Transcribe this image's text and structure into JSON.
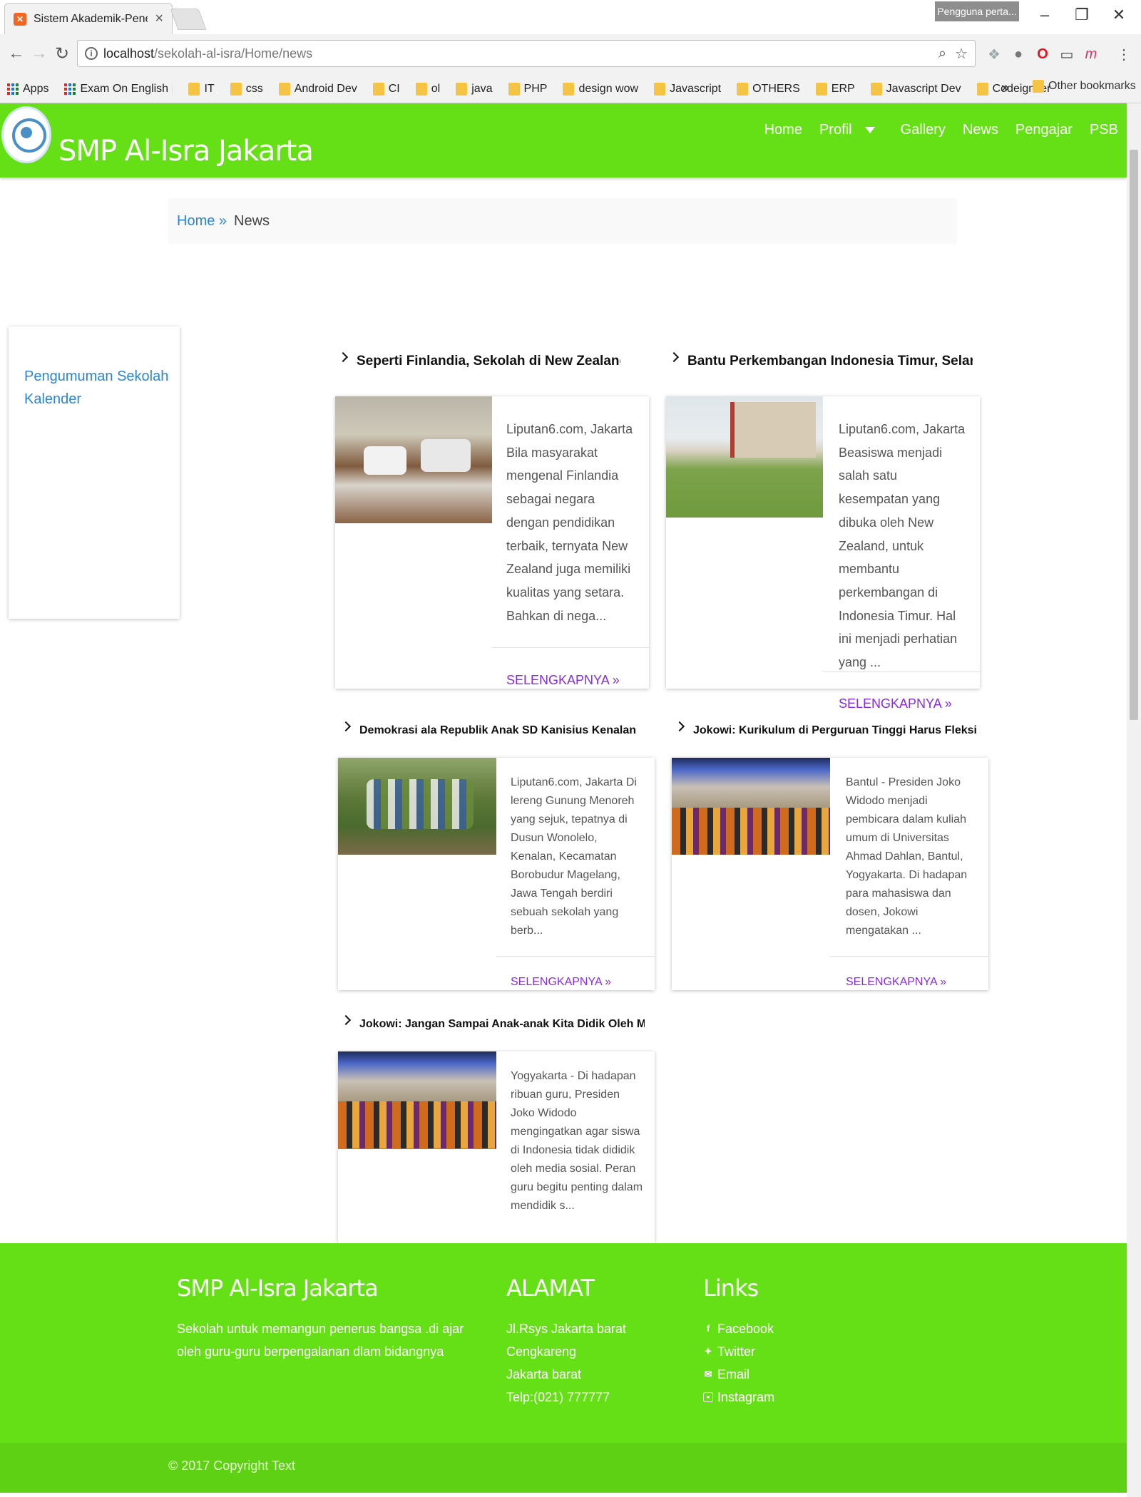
{
  "browser": {
    "tab_title": "Sistem Akademik-Peneri",
    "profile": "Pengguna perta...",
    "url_host": "localhost",
    "url_path": "/sekolah-al-isra/Home/news",
    "bookmarks": [
      {
        "label": "Apps",
        "type": "apps"
      },
      {
        "label": "Exam On English | ne",
        "type": "site"
      },
      {
        "label": "IT",
        "type": "folder"
      },
      {
        "label": "css",
        "type": "folder"
      },
      {
        "label": "Android Dev",
        "type": "folder"
      },
      {
        "label": "CI",
        "type": "folder"
      },
      {
        "label": "ol",
        "type": "folder"
      },
      {
        "label": "java",
        "type": "folder"
      },
      {
        "label": "PHP",
        "type": "folder"
      },
      {
        "label": "design wow",
        "type": "folder"
      },
      {
        "label": "Javascript",
        "type": "folder"
      },
      {
        "label": "OTHERS",
        "type": "folder"
      },
      {
        "label": "ERP",
        "type": "folder"
      },
      {
        "label": "Javascript Dev",
        "type": "folder"
      },
      {
        "label": "Codeigniter",
        "type": "folder"
      }
    ],
    "bookmarks_more": "»",
    "other_bookmarks": "Other bookmarks"
  },
  "site": {
    "brand": "SMP Al-Isra Jakarta",
    "nav": [
      "Home",
      "Profil",
      "Gallery",
      "News",
      "Pengajar",
      "PSB"
    ],
    "accent_color": "#66e016"
  },
  "breadcrumb": {
    "home": "Home »",
    "current": "News"
  },
  "sidebar": {
    "links": [
      "Pengumuman Sekolah",
      "Kalender"
    ]
  },
  "news": [
    {
      "title": "Seperti Finlandia, Sekolah di New Zealand Seperti",
      "excerpt": "Liputan6.com, Jakarta Bila masyarakat mengenal Finlandia sebagai negara dengan pendidikan terbaik, ternyata New Zealand juga memiliki kualitas yang setara. Bahkan di nega...",
      "more": "SELENGKAPNYA »"
    },
    {
      "title": "Bantu Perkembangan Indonesia Timur, Selandia Baru",
      "excerpt": "Liputan6.com, Jakarta Beasiswa menjadi salah satu kesempatan yang dibuka oleh New Zealand, untuk membantu perkembangan di Indonesia Timur. Hal ini menjadi perhatian yang ...",
      "more": "SELENGKAPNYA »"
    },
    {
      "title": "Demokrasi ala Republik Anak SD Kanisius Kenalan",
      "excerpt": "Liputan6.com, Jakarta Di lereng Gunung Menoreh yang sejuk, tepatnya di Dusun Wonolelo, Kenalan, Kecamatan Borobudur Magelang, Jawa Tengah berdiri sebuah sekolah yang berb...",
      "more": "SELENGKAPNYA »"
    },
    {
      "title": "Jokowi: Kurikulum di Perguruan Tinggi Harus Fleksi",
      "excerpt": "Bantul - Presiden Joko Widodo menjadi pembicara dalam kuliah umum di Universitas Ahmad Dahlan, Bantul, Yogyakarta. Di hadapan para mahasiswa dan dosen, Jokowi mengatakan ...",
      "more": "SELENGKAPNYA »"
    },
    {
      "title": "Jokowi: Jangan Sampai Anak-anak Kita Didik Oleh Me",
      "excerpt": "Yogyakarta - Di hadapan ribuan guru, Presiden Joko Widodo mengingatkan agar siswa di Indonesia tidak dididik oleh media sosial. Peran guru begitu penting dalam mendidik s..."
    }
  ],
  "footer": {
    "about_heading": "SMP Al-Isra Jakarta",
    "about_text": "Sekolah untuk memangun penerus bangsa .di ajar oleh guru-guru berpengalanan dlam bidangnya",
    "address_heading": "ALAMAT",
    "address_lines": [
      "Jl.Rsys Jakarta barat",
      "Cengkareng",
      "Jakarta barat",
      "Telp:(021) 777777"
    ],
    "links_heading": "Links",
    "links": [
      "Facebook",
      "Twitter",
      "Email",
      "Instagram"
    ],
    "copyright": "© 2017 Copyright Text"
  }
}
